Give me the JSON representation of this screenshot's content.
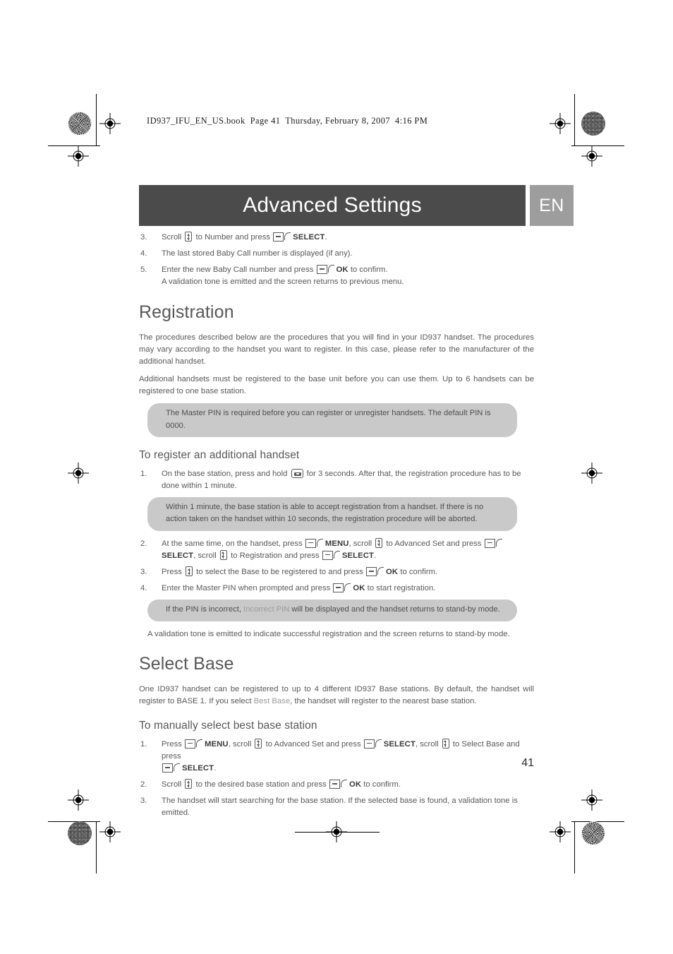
{
  "print_header": {
    "file_info": "ID937_IFU_EN_US.book  Page 41  Thursday, February 8, 2007  4:16 PM"
  },
  "header": {
    "title": "Advanced Settings",
    "language_badge": "EN",
    "banner_color": "#4b4b4b",
    "badge_color": "#9d9d9d"
  },
  "top_steps": [
    {
      "num": "3.",
      "parts": [
        {
          "t": "text",
          "v": "Scroll "
        },
        {
          "t": "icon",
          "v": "scroll-icon"
        },
        {
          "t": "text",
          "v": " to Number and press "
        },
        {
          "t": "icon",
          "v": "softkey-icon"
        },
        {
          "t": "key",
          "v": "SELECT"
        },
        {
          "t": "text",
          "v": "."
        }
      ]
    },
    {
      "num": "4.",
      "parts": [
        {
          "t": "text",
          "v": "The last stored Baby Call number is displayed (if any)."
        }
      ]
    },
    {
      "num": "5.",
      "parts": [
        {
          "t": "text",
          "v": "Enter the new Baby Call number and press "
        },
        {
          "t": "icon",
          "v": "softkey-icon"
        },
        {
          "t": "key",
          "v": "OK"
        },
        {
          "t": "text",
          "v": " to confirm."
        },
        {
          "t": "br",
          "v": ""
        },
        {
          "t": "text",
          "v": "A validation tone is emitted and the screen returns to previous menu."
        }
      ]
    }
  ],
  "registration": {
    "heading": "Registration",
    "paragraphs": [
      "The procedures described below are the procedures that you will find in your ID937 handset. The procedures may vary according to the handset you want to register. In this case, please refer to the manufacturer of the additional handset.",
      "Additional handsets must be registered to the base unit before you can use them. Up to 6 handsets can be registered to one base station."
    ],
    "tip_1": "The Master PIN is required before you can register or unregister handsets. The default PIN is 0000.",
    "subheading": "To register an additional handset",
    "step_1": {
      "num": "1.",
      "parts": [
        {
          "t": "text",
          "v": "On the base station, press and hold "
        },
        {
          "t": "icon",
          "v": "paging-button-icon"
        },
        {
          "t": "text",
          "v": "   for 3 seconds. After that, the registration procedure has to be done within 1 minute."
        }
      ]
    },
    "tip_2": "Within 1 minute, the base station is able to accept registration from a handset. If there is no action taken on the handset within 10 seconds, the registration procedure will be aborted.",
    "steps_rest": [
      {
        "num": "2.",
        "parts": [
          {
            "t": "text",
            "v": "At the same time, on the handset, press "
          },
          {
            "t": "icon",
            "v": "softkey-icon"
          },
          {
            "t": "key",
            "v": "MENU"
          },
          {
            "t": "text",
            "v": ", scroll "
          },
          {
            "t": "icon",
            "v": "scroll-icon"
          },
          {
            "t": "text",
            "v": " to Advanced Set and press "
          },
          {
            "t": "icon",
            "v": "softkey-icon"
          },
          {
            "t": "key",
            "v": "SELECT"
          },
          {
            "t": "text",
            "v": ", scroll "
          },
          {
            "t": "icon",
            "v": "scroll-icon"
          },
          {
            "t": "text",
            "v": " to Registration and press "
          },
          {
            "t": "icon",
            "v": "softkey-icon"
          },
          {
            "t": "key",
            "v": "SELECT"
          },
          {
            "t": "text",
            "v": "."
          }
        ]
      },
      {
        "num": "3.",
        "parts": [
          {
            "t": "text",
            "v": "Press "
          },
          {
            "t": "icon",
            "v": "scroll-icon"
          },
          {
            "t": "text",
            "v": " to select the Base to be registered to and press "
          },
          {
            "t": "icon",
            "v": "softkey-icon"
          },
          {
            "t": "key",
            "v": "OK"
          },
          {
            "t": "text",
            "v": " to confirm."
          }
        ]
      },
      {
        "num": "4.",
        "parts": [
          {
            "t": "text",
            "v": "Enter the Master PIN when prompted and press "
          },
          {
            "t": "icon",
            "v": "softkey-icon"
          },
          {
            "t": "key",
            "v": "OK"
          },
          {
            "t": "text",
            "v": " to start registration."
          }
        ]
      }
    ],
    "tip_3_parts": [
      {
        "t": "text",
        "v": "If the PIN is incorrect, "
      },
      {
        "t": "screen",
        "v": "Incorrect PIN"
      },
      {
        "t": "text",
        "v": " will be displayed and the handset returns to stand-by mode."
      }
    ],
    "closing_paragraph": "A validation tone is emitted to indicate successful registration and the screen returns to stand-by mode."
  },
  "select_base": {
    "heading": "Select Base",
    "paragraph_parts": [
      {
        "t": "text",
        "v": "One ID937 handset can be registered to up to 4 different ID937 Base stations. By default, the handset will register to BASE 1. If you select "
      },
      {
        "t": "screen",
        "v": "Best Base"
      },
      {
        "t": "text",
        "v": ", the handset will register to the nearest base station."
      }
    ],
    "subheading": "To manually select best base station",
    "steps": [
      {
        "num": "1.",
        "parts": [
          {
            "t": "text",
            "v": "Press "
          },
          {
            "t": "icon",
            "v": "softkey-icon"
          },
          {
            "t": "key",
            "v": "MENU"
          },
          {
            "t": "text",
            "v": ", scroll "
          },
          {
            "t": "icon",
            "v": "scroll-icon"
          },
          {
            "t": "text",
            "v": " to Advanced Set and press "
          },
          {
            "t": "icon",
            "v": "softkey-icon"
          },
          {
            "t": "key",
            "v": "SELECT"
          },
          {
            "t": "text",
            "v": ", scroll "
          },
          {
            "t": "icon",
            "v": "scroll-icon"
          },
          {
            "t": "text",
            "v": " to Select Base and press "
          },
          {
            "t": "br",
            "v": ""
          },
          {
            "t": "icon",
            "v": "softkey-icon"
          },
          {
            "t": "key",
            "v": "SELECT"
          },
          {
            "t": "text",
            "v": "."
          }
        ]
      },
      {
        "num": "2.",
        "parts": [
          {
            "t": "text",
            "v": "Scroll "
          },
          {
            "t": "icon",
            "v": "scroll-icon"
          },
          {
            "t": "text",
            "v": " to the desired base station and press "
          },
          {
            "t": "icon",
            "v": "softkey-icon"
          },
          {
            "t": "key",
            "v": "OK"
          },
          {
            "t": "text",
            "v": " to confirm."
          }
        ]
      },
      {
        "num": "3.",
        "parts": [
          {
            "t": "text",
            "v": "The handset will start searching for the base station. If the selected base is found, a validation tone is emitted."
          }
        ]
      }
    ]
  },
  "footer": {
    "page_number": "41"
  }
}
